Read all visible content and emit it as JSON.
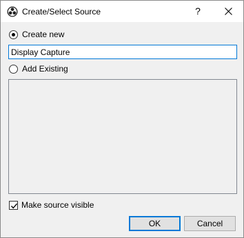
{
  "window": {
    "title": "Create/Select Source",
    "help_label": "?",
    "close_icon": "close-icon",
    "app_icon": "obs-logo-icon"
  },
  "create_new": {
    "label": "Create new",
    "selected": true,
    "name_value": "Display Capture"
  },
  "add_existing": {
    "label": "Add Existing",
    "selected": false,
    "items": []
  },
  "make_visible": {
    "label": "Make source visible",
    "checked": true
  },
  "buttons": {
    "ok": "OK",
    "cancel": "Cancel"
  },
  "colors": {
    "focus_accent": "#0078d7",
    "dialog_bg": "#f0f0f0"
  }
}
